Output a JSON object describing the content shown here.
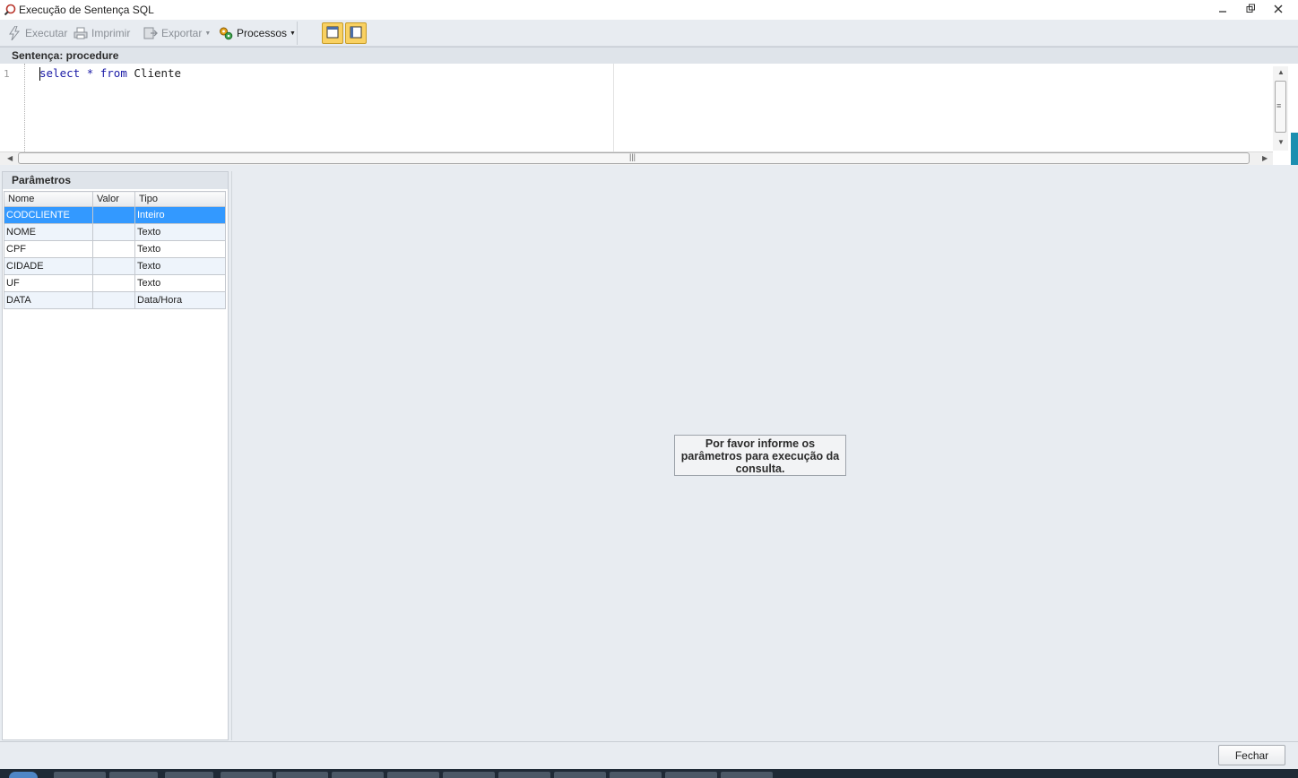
{
  "window": {
    "title": "Execução de Sentença SQL",
    "icons": [
      "sql-app-icon",
      "minimize-icon",
      "restore-icon",
      "close-icon"
    ]
  },
  "toolbar": {
    "execute_label": "Executar",
    "print_label": "Imprimir",
    "export_label": "Exportar",
    "processes_label": "Processos"
  },
  "sentence": {
    "header": "Sentença: procedure",
    "line_number": "1",
    "code": {
      "kw_select": "select",
      "op_star": "*",
      "kw_from": "from",
      "table": "Cliente"
    }
  },
  "params": {
    "header": "Parâmetros",
    "columns": [
      "Nome",
      "Valor",
      "Tipo"
    ],
    "rows": [
      {
        "nome": "CODCLIENTE",
        "valor": "",
        "tipo": "Inteiro"
      },
      {
        "nome": "NOME",
        "valor": "",
        "tipo": "Texto"
      },
      {
        "nome": "CPF",
        "valor": "",
        "tipo": "Texto"
      },
      {
        "nome": "CIDADE",
        "valor": "",
        "tipo": "Texto"
      },
      {
        "nome": "UF",
        "valor": "",
        "tipo": "Texto"
      },
      {
        "nome": "DATA",
        "valor": "",
        "tipo": "Data/Hora"
      }
    ],
    "selected_row": 0
  },
  "result": {
    "message": "Por favor informe os parâmetros para execução da consulta."
  },
  "footer": {
    "close_label": "Fechar"
  },
  "colors": {
    "accent": "#f9d162",
    "selection": "#3399ff",
    "keyword": "#1a1aa6"
  }
}
